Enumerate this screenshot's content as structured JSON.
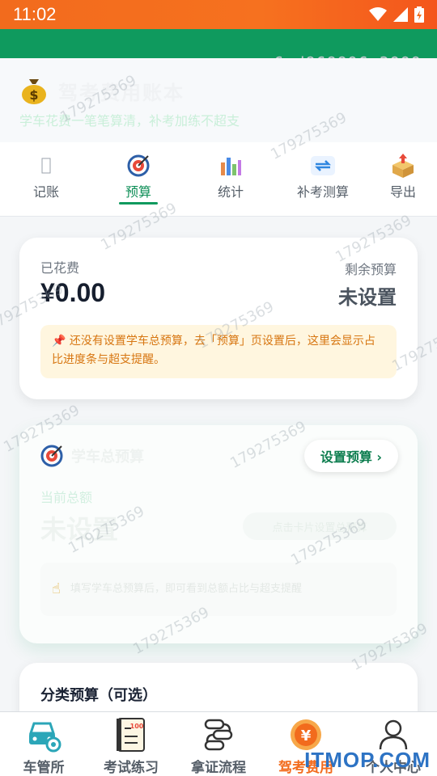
{
  "status_bar": {
    "time": "11:02"
  },
  "watermark_code": "e6ad868896e3999a",
  "header": {
    "title": "驾考费用账本",
    "subtitle": "学车花费一笔笔算清，补考加练不超支"
  },
  "tabs": [
    {
      "label": "记账",
      "icon": "ledger-icon"
    },
    {
      "label": "预算",
      "icon": "target-icon",
      "active": true
    },
    {
      "label": "统计",
      "icon": "bar-chart-icon"
    },
    {
      "label": "补考测算",
      "icon": "repeat-icon"
    },
    {
      "label": "导出",
      "icon": "export-box-icon"
    }
  ],
  "summary": {
    "spent_label": "已花费",
    "spent_value": "¥0.00",
    "remaining_label": "剩余预算",
    "remaining_value": "未设置",
    "tip": "📌 还没有设置学车总预算，去「预算」页设置后，这里会显示占比进度条与超支提醒。"
  },
  "budget_card": {
    "title": "学车总预算",
    "set_button": "设置预算 ›",
    "current_label": "当前总额",
    "current_value": "未设置",
    "pill": "点击卡片设置总预算",
    "hint": "填写学车总预算后，即可看到总额占比与超支提醒"
  },
  "category_card": {
    "title": "分类预算（可选）"
  },
  "bottom_nav": [
    {
      "label": "车管所",
      "icon": "car-service-icon"
    },
    {
      "label": "考试练习",
      "icon": "exam-notebook-icon"
    },
    {
      "label": "拿证流程",
      "icon": "process-flow-icon"
    },
    {
      "label": "驾考费用",
      "icon": "yen-coin-icon",
      "active": true
    },
    {
      "label": "个人中心",
      "icon": "user-icon"
    }
  ],
  "watermark_number": "179275369",
  "site_watermark": "ITMOP.COM",
  "colors": {
    "brand_green": "#0f9a5e",
    "accent_orange": "#f26b1d",
    "status_bar": "#f26b1d"
  }
}
